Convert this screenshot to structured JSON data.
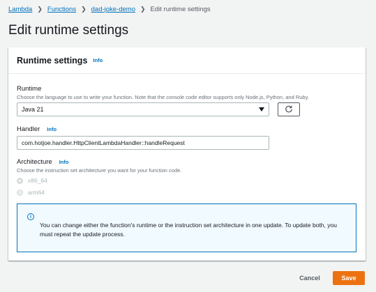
{
  "breadcrumb": {
    "items": [
      "Lambda",
      "Functions",
      "dad-joke-demo"
    ],
    "current": "Edit runtime settings"
  },
  "page_title": "Edit runtime settings",
  "panel": {
    "title": "Runtime settings",
    "info_label": "Info"
  },
  "runtime": {
    "label": "Runtime",
    "description": "Choose the language to use to write your function. Note that the console code editor supports only Node.js, Python, and Ruby.",
    "value": "Java 21"
  },
  "handler": {
    "label": "Handler",
    "info_label": "Info",
    "value": "com.hotjoe.handler.HttpClientLambdaHandler::handleRequest"
  },
  "architecture": {
    "label": "Architecture",
    "info_label": "Info",
    "description": "Choose the instruction set architecture you want for your function code.",
    "options": [
      "x86_64",
      "arm64"
    ]
  },
  "alert": {
    "text": "You can change either the function's runtime or the instruction set architecture in one update. To update both, you must repeat the update process."
  },
  "footer": {
    "cancel_label": "Cancel",
    "save_label": "Save"
  },
  "colors": {
    "link": "#0073bb",
    "primary": "#ec7211",
    "background": "#f2f3f3"
  }
}
